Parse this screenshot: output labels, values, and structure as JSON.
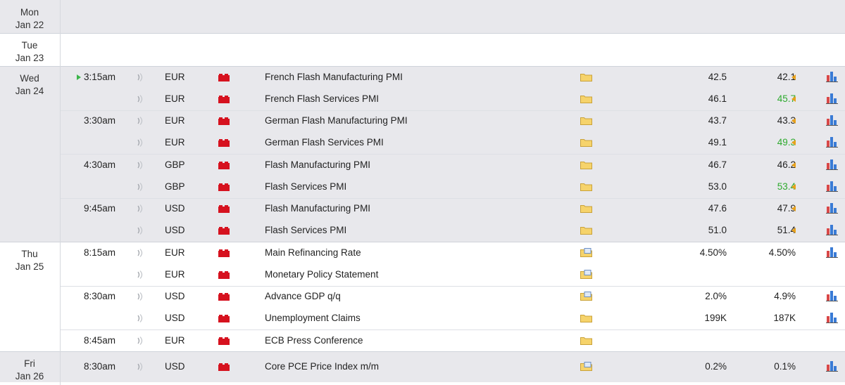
{
  "colors": {
    "shaded_row": "#e8e8ec",
    "impact_high": "#d6121f",
    "better_than_forecast": "#2eaa2e",
    "revision_arrow": "#e8a11a"
  },
  "icons": {
    "sound": "speaker-wave-icon",
    "impact": "high-impact-folder-icon",
    "detail": "folder-icon",
    "detail_open": "folder-open-icon",
    "graph": "bar-chart-icon",
    "revision": "revision-arrow-icon",
    "next": "play-triangle-icon"
  },
  "days": [
    {
      "day": "Mon",
      "date": "Jan 22",
      "events": []
    },
    {
      "day": "Tue",
      "date": "Jan 23",
      "events": []
    },
    {
      "day": "Wed",
      "date": "Jan 24",
      "events": [
        {
          "time": "3:15am",
          "currency": "EUR",
          "title": "French Flash Manufacturing PMI",
          "actual": "42.5",
          "forecast": "42.1",
          "forecast_better": false,
          "revised": true,
          "graph": true
        },
        {
          "time": "",
          "currency": "EUR",
          "title": "French Flash Services PMI",
          "actual": "46.1",
          "forecast": "45.7",
          "forecast_better": true,
          "revised": true,
          "graph": true
        },
        {
          "time": "3:30am",
          "currency": "EUR",
          "title": "German Flash Manufacturing PMI",
          "actual": "43.7",
          "forecast": "43.3",
          "forecast_better": false,
          "revised": true,
          "graph": true
        },
        {
          "time": "",
          "currency": "EUR",
          "title": "German Flash Services PMI",
          "actual": "49.1",
          "forecast": "49.3",
          "forecast_better": true,
          "revised": true,
          "graph": true
        },
        {
          "time": "4:30am",
          "currency": "GBP",
          "title": "Flash Manufacturing PMI",
          "actual": "46.7",
          "forecast": "46.2",
          "forecast_better": false,
          "revised": true,
          "graph": true
        },
        {
          "time": "",
          "currency": "GBP",
          "title": "Flash Services PMI",
          "actual": "53.0",
          "forecast": "53.4",
          "forecast_better": true,
          "revised": true,
          "graph": true
        },
        {
          "time": "9:45am",
          "currency": "USD",
          "title": "Flash Manufacturing PMI",
          "actual": "47.6",
          "forecast": "47.9",
          "forecast_better": false,
          "revised": true,
          "graph": true
        },
        {
          "time": "",
          "currency": "USD",
          "title": "Flash Services PMI",
          "actual": "51.0",
          "forecast": "51.4",
          "forecast_better": false,
          "revised": true,
          "graph": true
        }
      ]
    },
    {
      "day": "Thu",
      "date": "Jan 25",
      "events": [
        {
          "time": "8:15am",
          "currency": "EUR",
          "title": "Main Refinancing Rate",
          "actual": "4.50%",
          "forecast": "4.50%",
          "forecast_better": false,
          "revised": false,
          "graph": true
        },
        {
          "time": "",
          "currency": "EUR",
          "title": "Monetary Policy Statement",
          "actual": "",
          "forecast": "",
          "forecast_better": false,
          "revised": false,
          "graph": false
        },
        {
          "time": "8:30am",
          "currency": "USD",
          "title": "Advance GDP q/q",
          "actual": "2.0%",
          "forecast": "4.9%",
          "forecast_better": false,
          "revised": false,
          "graph": true
        },
        {
          "time": "",
          "currency": "USD",
          "title": "Unemployment Claims",
          "actual": "199K",
          "forecast": "187K",
          "forecast_better": false,
          "revised": false,
          "graph": true
        },
        {
          "time": "8:45am",
          "currency": "EUR",
          "title": "ECB Press Conference",
          "actual": "",
          "forecast": "",
          "forecast_better": false,
          "revised": false,
          "graph": false
        }
      ]
    },
    {
      "day": "Fri",
      "date": "Jan 26",
      "events": [
        {
          "time": "8:30am",
          "currency": "USD",
          "title": "Core PCE Price Index m/m",
          "actual": "0.2%",
          "forecast": "0.1%",
          "forecast_better": false,
          "revised": false,
          "graph": true
        }
      ]
    }
  ]
}
